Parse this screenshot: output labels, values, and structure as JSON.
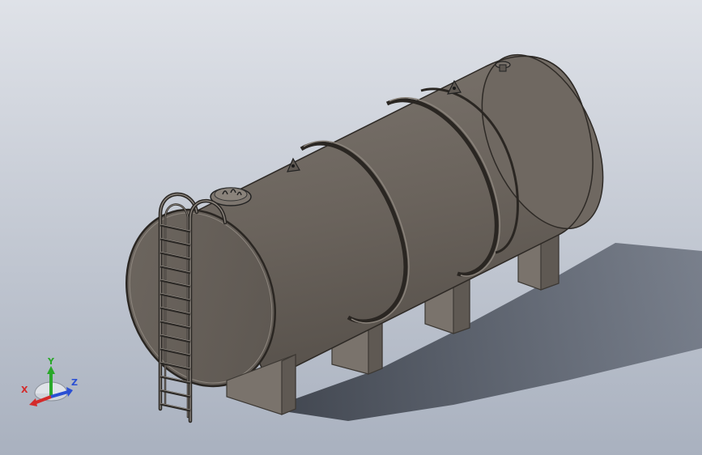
{
  "viewport": {
    "background_top": "#d8dce3",
    "background_bottom": "#aab2c0",
    "tank_color": "#6b645d",
    "tank_dark": "#4e4842",
    "tank_light": "#847d75",
    "saddle_color": "#716a63",
    "shadow_color": "#3a3e46"
  },
  "triad": {
    "x_label": "X",
    "y_label": "Y",
    "z_label": "Z",
    "x_color": "#d42a2a",
    "y_color": "#2aa82a",
    "z_color": "#2a4fd4"
  }
}
